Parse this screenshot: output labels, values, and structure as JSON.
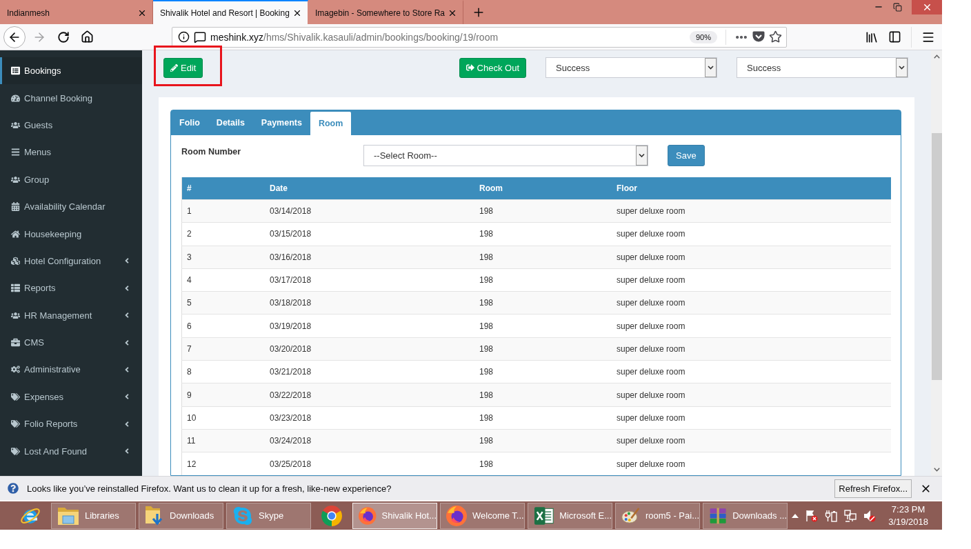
{
  "browser": {
    "tabs": [
      {
        "title": "Indianmesh",
        "selected": false
      },
      {
        "title": "Shivalik Hotel and Resort | Booking",
        "selected": true
      },
      {
        "title": "Imagebin - Somewhere to Store Ra",
        "selected": false
      }
    ],
    "address": {
      "host": "meshink.xyz",
      "path": "/hms/Shivalik.kasauli/admin/bookings/booking/19/room",
      "zoom": "90%"
    }
  },
  "sidebar": {
    "items": [
      {
        "label": "Bookings",
        "selected": true,
        "submenu": false
      },
      {
        "label": "Channel Booking",
        "selected": false,
        "submenu": false
      },
      {
        "label": "Guests",
        "selected": false,
        "submenu": false
      },
      {
        "label": "Menus",
        "selected": false,
        "submenu": false
      },
      {
        "label": "Group",
        "selected": false,
        "submenu": false
      },
      {
        "label": "Availability Calendar",
        "selected": false,
        "submenu": false
      },
      {
        "label": "Housekeeping",
        "selected": false,
        "submenu": false
      },
      {
        "label": "Hotel Configuration",
        "selected": false,
        "submenu": true
      },
      {
        "label": "Reports",
        "selected": false,
        "submenu": true
      },
      {
        "label": "HR Management",
        "selected": false,
        "submenu": true
      },
      {
        "label": "CMS",
        "selected": false,
        "submenu": true
      },
      {
        "label": "Administrative",
        "selected": false,
        "submenu": true
      },
      {
        "label": "Expenses",
        "selected": false,
        "submenu": true
      },
      {
        "label": "Folio Reports",
        "selected": false,
        "submenu": true
      },
      {
        "label": "Lost And Found",
        "selected": false,
        "submenu": true
      }
    ]
  },
  "toolbar": {
    "edit_button": {
      "label": "Edit",
      "highlighted": true
    },
    "checkout_button": "Check Out",
    "status_selects": [
      {
        "value": "Success"
      },
      {
        "value": "Success"
      }
    ]
  },
  "booking_panel": {
    "tabs": [
      {
        "label": "Folio",
        "selected": false
      },
      {
        "label": "Details",
        "selected": false
      },
      {
        "label": "Payments",
        "selected": false
      },
      {
        "label": "Room",
        "selected": true
      }
    ],
    "room_number_label": "Room Number",
    "room_select": {
      "value": "--Select Room--"
    },
    "save_button": "Save",
    "table": {
      "columns": [
        "#",
        "Date",
        "Room",
        "Floor"
      ],
      "rows": [
        [
          "1",
          "03/14/2018",
          "198",
          "super deluxe room"
        ],
        [
          "2",
          "03/15/2018",
          "198",
          "super deluxe room"
        ],
        [
          "3",
          "03/16/2018",
          "198",
          "super deluxe room"
        ],
        [
          "4",
          "03/17/2018",
          "198",
          "super deluxe room"
        ],
        [
          "5",
          "03/18/2018",
          "198",
          "super deluxe room"
        ],
        [
          "6",
          "03/19/2018",
          "198",
          "super deluxe room"
        ],
        [
          "7",
          "03/20/2018",
          "198",
          "super deluxe room"
        ],
        [
          "8",
          "03/21/2018",
          "198",
          "super deluxe room"
        ],
        [
          "9",
          "03/22/2018",
          "198",
          "super deluxe room"
        ],
        [
          "10",
          "03/23/2018",
          "198",
          "super deluxe room"
        ],
        [
          "11",
          "03/24/2018",
          "198",
          "super deluxe room"
        ],
        [
          "12",
          "03/25/2018",
          "198",
          "super deluxe room"
        ]
      ]
    }
  },
  "notification": {
    "message": "Looks like you’ve reinstalled Firefox. Want us to clean it up for a fresh, like-new experience?",
    "button": "Refresh Firefox..."
  },
  "taskbar": {
    "items": [
      {
        "kind": "pinned",
        "selected": false
      },
      {
        "kind": "window",
        "label": "Libraries",
        "selected": false
      },
      {
        "kind": "window",
        "label": "Downloads",
        "selected": false
      },
      {
        "kind": "window",
        "label": "Skype",
        "selected": false
      },
      {
        "kind": "pinned",
        "selected": false
      },
      {
        "kind": "window",
        "label": "Shivalik Hot...",
        "selected": true
      },
      {
        "kind": "window",
        "label": "Welcome T...",
        "selected": false
      },
      {
        "kind": "window",
        "label": "Microsoft E...",
        "selected": false
      },
      {
        "kind": "window",
        "label": "room5 - Pai...",
        "selected": false
      },
      {
        "kind": "window",
        "label": "Downloads ...",
        "selected": false
      }
    ],
    "clock": {
      "time": "7:23 PM",
      "date": "3/19/2018"
    }
  }
}
